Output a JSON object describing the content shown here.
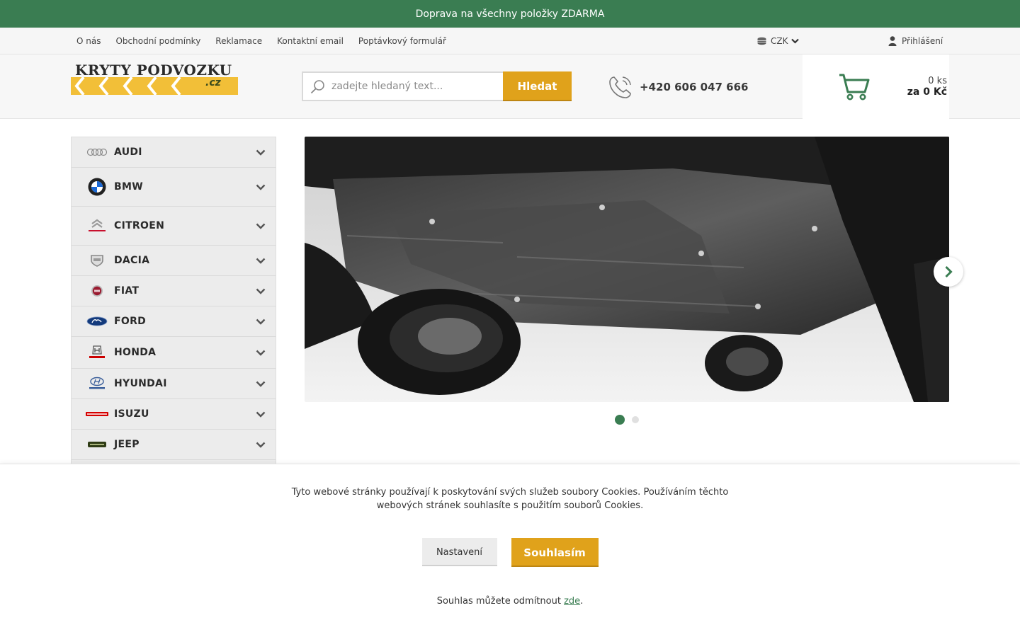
{
  "promo": {
    "text": "Doprava na všechny položky ZDARMA"
  },
  "topnav": {
    "links": [
      "O nás",
      "Obchodní podmínky",
      "Reklamace",
      "Kontaktní email",
      "Poptávkový formulář"
    ],
    "currency": "CZK",
    "login": "Přihlášení"
  },
  "header": {
    "logo_text": "KRYTY PODVOZKU",
    "logo_suffix": ".cz",
    "search_placeholder": "zadejte hledaný text...",
    "search_button": "Hledat",
    "phone": "+420 606 047 666",
    "cart_count": "0 ks",
    "cart_total": "za 0 Kč"
  },
  "brands": [
    {
      "name": "AUDI",
      "icon": "audi-rings-icon",
      "color": "#9a9a9a"
    },
    {
      "name": "BMW",
      "icon": "bmw-roundel-icon",
      "color": "#1c69d4"
    },
    {
      "name": "CITROEN",
      "icon": "citroen-chevrons-icon",
      "color": "#c8102e"
    },
    {
      "name": "DACIA",
      "icon": "dacia-shield-icon",
      "color": "#8a8a8a"
    },
    {
      "name": "FIAT",
      "icon": "fiat-badge-icon",
      "color": "#9b1b30"
    },
    {
      "name": "FORD",
      "icon": "ford-oval-icon",
      "color": "#133a7c"
    },
    {
      "name": "HONDA",
      "icon": "honda-h-icon",
      "color": "#cc0000"
    },
    {
      "name": "HYUNDAI",
      "icon": "hyundai-h-icon",
      "color": "#002c5f"
    },
    {
      "name": "ISUZU",
      "icon": "isuzu-wordmark-icon",
      "color": "#d50000"
    },
    {
      "name": "JEEP",
      "icon": "jeep-wordmark-icon",
      "color": "#2e3b14"
    }
  ],
  "slider": {
    "slides": 2,
    "active": 0
  },
  "cookie": {
    "text": "Tyto webové stránky používají k poskytování svých služeb soubory Cookies. Používáním těchto webových stránek souhlasíte s použitím souborů Cookies.",
    "settings": "Nastavení",
    "agree": "Souhlasím",
    "refuse_prefix": "Souhlas můžete odmítnout ",
    "refuse_link": "zde",
    "refuse_suffix": "."
  },
  "colors": {
    "green": "#3a7d52",
    "accent": "#e0a21b",
    "logo_yellow": "#f2bf38"
  }
}
